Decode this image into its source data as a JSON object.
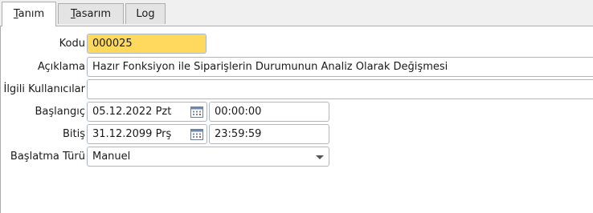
{
  "tabs": [
    {
      "label": "Tanım",
      "mnemonic": "T",
      "rest": "anım",
      "active": true
    },
    {
      "label": "Tasarım",
      "mnemonic": "T",
      "rest": "asarım",
      "active": false
    },
    {
      "label": "Log",
      "mnemonic": "",
      "rest": "Log",
      "active": false
    }
  ],
  "form": {
    "kodu_label": "Kodu",
    "kodu_value": "000025",
    "aciklama_label": "Açıklama",
    "aciklama_value": "Hazır Fonksiyon ile Siparişlerin Durumunun Analiz Olarak Değişmesi",
    "ilgili_label": "İlgili Kullanıcılar",
    "ilgili_value": "",
    "baslangic_label": "Başlangıç",
    "baslangic_date": "05.12.2022 Pzt",
    "baslangic_time": "00:00:00",
    "bitis_label": "Bitiş",
    "bitis_date": "31.12.2099 Prş",
    "bitis_time": "23:59:59",
    "baslatma_label": "Başlatma Türü",
    "baslatma_value": "Manuel"
  },
  "icons": {
    "calendar": "calendar-icon",
    "dropdown": "chevron-down-icon"
  },
  "colors": {
    "highlight_field": "#fed95e",
    "field_border": "#a9b8c9"
  }
}
